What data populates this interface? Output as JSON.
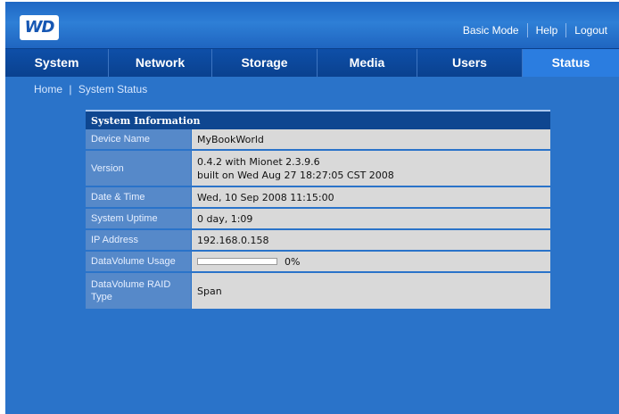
{
  "brand": {
    "logo_text": "WD"
  },
  "header": {
    "links": [
      "Basic Mode",
      "Help",
      "Logout"
    ]
  },
  "nav": {
    "tabs": [
      "System",
      "Network",
      "Storage",
      "Media",
      "Users",
      "Status"
    ],
    "active": "Status"
  },
  "breadcrumb": {
    "home": "Home",
    "separator": "|",
    "current": "System Status"
  },
  "panel": {
    "title": "System Information",
    "rows": {
      "device_name": {
        "label": "Device Name",
        "value": "MyBookWorld"
      },
      "version": {
        "label": "Version",
        "value_line1": "0.4.2 with Mionet 2.3.9.6",
        "value_line2": "built on Wed Aug 27 18:27:05 CST 2008"
      },
      "date_time": {
        "label": "Date & Time",
        "value": "Wed, 10 Sep 2008 11:15:00"
      },
      "uptime": {
        "label": "System Uptime",
        "value": "0 day, 1:09"
      },
      "ip": {
        "label": "IP Address",
        "value": "192.168.0.158"
      },
      "usage": {
        "label": "DataVolume Usage",
        "percent_text": "0%",
        "percent": 0
      },
      "raid": {
        "label": "DataVolume RAID Type",
        "value": "Span"
      }
    }
  },
  "colors": {
    "accent": "#2a73c9",
    "nav": "#0a418f",
    "active_tab": "#2b7de0"
  }
}
